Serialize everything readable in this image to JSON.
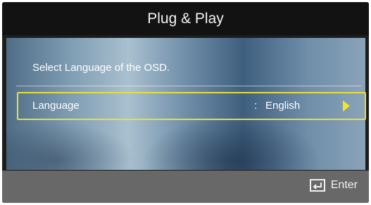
{
  "window": {
    "title": "Plug & Play"
  },
  "main": {
    "prompt": "Select Language of the OSD.",
    "setting": {
      "label": "Language",
      "separator": ":",
      "value": "English",
      "arrow_icon": "right-triangle-arrow-icon",
      "highlight_color": "#e8df3a"
    }
  },
  "footer": {
    "enter_label": "Enter",
    "enter_icon": "enter-key-icon"
  }
}
